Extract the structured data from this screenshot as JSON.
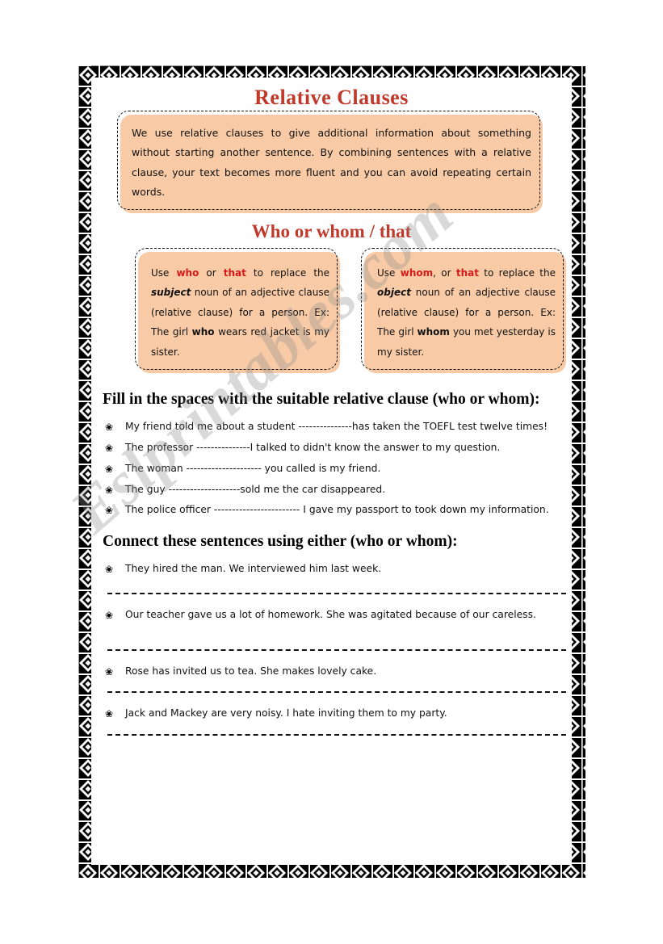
{
  "watermark": {
    "text": "Eslprintables.com"
  },
  "colors": {
    "title_red": "#c0392b",
    "keyword_red": "#d61a1a",
    "box_fill": "#f8cba6",
    "text_black": "#111111"
  },
  "title": "Relative Clauses",
  "intro": {
    "text": "We use relative clauses to give additional information about something without starting another sentence. By combining sentences with a relative clause, your text becomes more fluent and you can avoid repeating certain words."
  },
  "subtitle": "Who or whom / that",
  "who_box": {
    "p1_a": "Use ",
    "p1_who": "who",
    "p1_b": " or ",
    "p1_that": "that",
    "p1_c": " to replace the ",
    "p1_subject": "subject",
    "p1_d": " noun of an adjective clause (relative clause) for a person. Ex: The girl ",
    "p1_who2": "who",
    "p1_e": " wears red jacket is my sister."
  },
  "whom_box": {
    "p1_a": "Use ",
    "p1_whom": "whom",
    "p1_b": ", or ",
    "p1_that": "that",
    "p1_c": " to replace the ",
    "p1_object": "object",
    "p1_d": " noun of an adjective clause (relative clause) for a person. Ex: The girl ",
    "p1_whom2": "whom",
    "p1_e": " you met yesterday is my sister."
  },
  "exercise1": {
    "heading": "Fill in the spaces with the suitable relative clause (who or whom):",
    "bullet_glyph": "❀",
    "items": [
      "My friend told me about a student ---------------has taken the TOEFL test twelve times!",
      "The professor ---------------I talked to didn't know the answer to my question.",
      "The woman --------------------- you called is my friend.",
      "The guy --------------------sold me the car disappeared.",
      "The police officer ------------------------ I gave my passport to   took down my information."
    ]
  },
  "exercise2": {
    "heading": "Connect these sentences using either (who or whom):",
    "bullet_glyph": "❀",
    "items": [
      "They hired the man. We interviewed him last week.",
      "Our teacher gave us a lot of homework. She was agitated because of our careless.",
      "Rose has invited us to tea. She makes lovely cake.",
      "Jack and Mackey are very noisy. I hate inviting them to my party."
    ]
  }
}
